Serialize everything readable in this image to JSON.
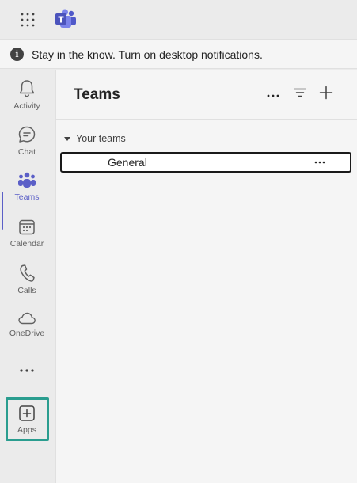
{
  "banner": {
    "text": "Stay in the know. Turn on desktop notifications.",
    "icon": "info-icon"
  },
  "rail": {
    "items": [
      {
        "label": "Activity",
        "icon": "bell-icon"
      },
      {
        "label": "Chat",
        "icon": "chat-icon"
      },
      {
        "label": "Teams",
        "icon": "teams-icon",
        "active": true
      },
      {
        "label": "Calendar",
        "icon": "calendar-icon"
      },
      {
        "label": "Calls",
        "icon": "phone-icon"
      },
      {
        "label": "OneDrive",
        "icon": "cloud-icon"
      },
      {
        "label": "",
        "icon": "more-apps-icon"
      },
      {
        "label": "Apps",
        "icon": "add-app-icon"
      }
    ]
  },
  "panel": {
    "title": "Teams",
    "section_label": "Your teams",
    "channels": [
      {
        "label": "General"
      }
    ]
  },
  "colors": {
    "accent": "#5b5fc7",
    "highlight": "#2a9d8f",
    "background": "#ebebeb",
    "panel": "#f5f5f5"
  }
}
